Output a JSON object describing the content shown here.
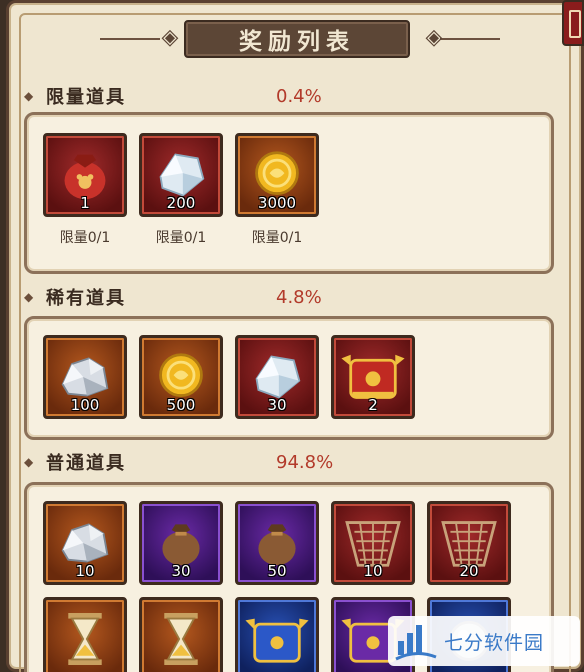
{
  "title": "奖励列表",
  "sections": [
    {
      "name": "限量道具",
      "rate": "0.4%",
      "items": [
        {
          "icon": "red-pouch-icon",
          "rarity": "red",
          "qty": "1",
          "limit": "限量0/1"
        },
        {
          "icon": "diamond-icon",
          "rarity": "red",
          "qty": "200",
          "limit": "限量0/1"
        },
        {
          "icon": "gold-coin-icon",
          "rarity": "orange",
          "qty": "3000",
          "limit": "限量0/1"
        }
      ]
    },
    {
      "name": "稀有道具",
      "rate": "4.8%",
      "items": [
        {
          "icon": "silver-ore-icon",
          "rarity": "orange",
          "qty": "100"
        },
        {
          "icon": "gold-coin-icon",
          "rarity": "orange",
          "qty": "500"
        },
        {
          "icon": "diamond-icon",
          "rarity": "red",
          "qty": "30"
        },
        {
          "icon": "red-armor-icon",
          "rarity": "red",
          "qty": "2"
        }
      ]
    },
    {
      "name": "普通道具",
      "rate": "94.8%",
      "items": [
        {
          "icon": "silver-ore-icon",
          "rarity": "orange",
          "qty": "10"
        },
        {
          "icon": "brown-pouch-icon",
          "rarity": "purple",
          "qty": "30"
        },
        {
          "icon": "brown-pouch-icon",
          "rarity": "purple",
          "qty": "50"
        },
        {
          "icon": "net-icon",
          "rarity": "red",
          "qty": "10"
        },
        {
          "icon": "net-icon",
          "rarity": "red",
          "qty": "20"
        },
        {
          "icon": "hourglass-icon",
          "rarity": "orange",
          "qty": ""
        },
        {
          "icon": "hourglass-icon",
          "rarity": "orange",
          "qty": ""
        },
        {
          "icon": "blue-armor-icon",
          "rarity": "blue",
          "qty": ""
        },
        {
          "icon": "purple-armor-icon",
          "rarity": "purple",
          "qty": ""
        },
        {
          "icon": "silver-orb-icon",
          "rarity": "blue",
          "qty": ""
        }
      ]
    }
  ],
  "watermark": "七分软件园",
  "colors": {
    "panel": "#efe6d0",
    "rate": "#b23a2a",
    "title_plaque": "#5c4636"
  }
}
